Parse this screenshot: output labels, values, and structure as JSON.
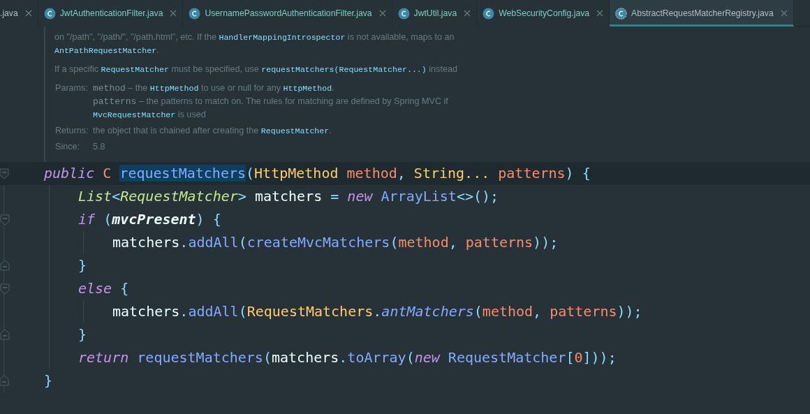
{
  "tabs": [
    {
      "label": ".java",
      "kind": "plain",
      "selected": false
    },
    {
      "label": "JwtAuthenticationFilter.java",
      "kind": "class",
      "selected": false
    },
    {
      "label": "UsernamePasswordAuthenticationFilter.java",
      "kind": "class",
      "selected": false
    },
    {
      "label": "JwtUtil.java",
      "kind": "class",
      "selected": false
    },
    {
      "label": "WebSecurityConfig.java",
      "kind": "class",
      "selected": false
    },
    {
      "label": "AbstractRequestMatcherRegistry.java",
      "kind": "abstract-class",
      "selected": true
    }
  ],
  "doc": {
    "paragraphs": [
      [
        {
          "kind": "text",
          "text": "on \"/path\", \"/path/\", \"/path.html\", etc. If the "
        },
        {
          "kind": "code",
          "text": "HandlerMappingIntrospector"
        },
        {
          "kind": "text",
          "text": " is not available, maps to an "
        },
        {
          "kind": "code",
          "text": "AntPathRequestMatcher"
        },
        {
          "kind": "text",
          "text": "."
        }
      ],
      [
        {
          "kind": "text",
          "text": "If a specific "
        },
        {
          "kind": "code",
          "text": "RequestMatcher"
        },
        {
          "kind": "text",
          "text": " must be specified, use "
        },
        {
          "kind": "code",
          "text": "requestMatchers(RequestMatcher...)"
        },
        {
          "kind": "text",
          "text": " instead"
        }
      ]
    ],
    "params_label": "Params:",
    "params": [
      {
        "name": "method",
        "segments": [
          {
            "kind": "text",
            "text": "– the "
          },
          {
            "kind": "code",
            "text": "HttpMethod"
          },
          {
            "kind": "text",
            "text": " to use or null for any "
          },
          {
            "kind": "code",
            "text": "HttpMethod"
          },
          {
            "kind": "text",
            "text": "."
          }
        ]
      },
      {
        "name": "patterns",
        "segments": [
          {
            "kind": "text",
            "text": "– the patterns to match on. The rules for matching are defined by Spring MVC if "
          },
          {
            "kind": "code",
            "text": "MvcRequestMatcher"
          },
          {
            "kind": "text",
            "text": " is used"
          }
        ]
      }
    ],
    "returns_label": "Returns:",
    "returns": [
      {
        "kind": "text",
        "text": "the object that is chained after creating the "
      },
      {
        "kind": "code",
        "text": "RequestMatcher"
      },
      {
        "kind": "text",
        "text": "."
      }
    ],
    "since_label": "Since:",
    "since": "5.8"
  },
  "code": [
    {
      "current": true,
      "kind": "fold-start",
      "tokens": [
        {
          "kind": "keyword",
          "text": "public "
        },
        {
          "kind": "typeparam",
          "text": "C "
        },
        {
          "kind": "selection",
          "text": "requestMatchers"
        },
        {
          "kind": "punct",
          "text": "("
        },
        {
          "kind": "type",
          "text": "HttpMethod "
        },
        {
          "kind": "param",
          "text": "method"
        },
        {
          "kind": "punct",
          "text": ", "
        },
        {
          "kind": "type",
          "text": "String... "
        },
        {
          "kind": "param",
          "text": "patterns"
        },
        {
          "kind": "punct",
          "text": ") {"
        }
      ],
      "children": [
        {
          "current": false,
          "tokens": [
            {
              "kind": "generic",
              "text": "List"
            },
            {
              "kind": "punct",
              "text": "<"
            },
            {
              "kind": "generic",
              "text": "RequestMatcher"
            },
            {
              "kind": "punct",
              "text": "> "
            },
            {
              "kind": "ident",
              "text": "matchers "
            },
            {
              "kind": "punct",
              "text": "= "
            },
            {
              "kind": "keyword",
              "text": "new "
            },
            {
              "kind": "method",
              "text": "ArrayList"
            },
            {
              "kind": "punct",
              "text": "<>();"
            }
          ]
        },
        {
          "current": false,
          "kind": "fold-start",
          "tokens": [
            {
              "kind": "keyword",
              "text": "if "
            },
            {
              "kind": "punct",
              "text": "("
            },
            {
              "kind": "field",
              "text": "mvcPresent"
            },
            {
              "kind": "punct",
              "text": ") {"
            }
          ],
          "children": [
            {
              "current": false,
              "tokens": [
                {
                  "kind": "ident",
                  "text": "matchers"
                },
                {
                  "kind": "punct",
                  "text": "."
                },
                {
                  "kind": "method",
                  "text": "addAll"
                },
                {
                  "kind": "punct",
                  "text": "("
                },
                {
                  "kind": "method",
                  "text": "createMvcMatchers"
                },
                {
                  "kind": "punct",
                  "text": "("
                },
                {
                  "kind": "param",
                  "text": "method"
                },
                {
                  "kind": "punct",
                  "text": ", "
                },
                {
                  "kind": "param",
                  "text": "patterns"
                },
                {
                  "kind": "punct",
                  "text": "));"
                }
              ]
            }
          ]
        },
        {
          "current": false,
          "kind": "fold-end",
          "tokens": [
            {
              "kind": "punct",
              "text": "}"
            }
          ]
        },
        {
          "current": false,
          "kind": "fold-start",
          "tokens": [
            {
              "kind": "keyword",
              "text": "else "
            },
            {
              "kind": "punct",
              "text": "{"
            }
          ],
          "children": [
            {
              "current": false,
              "tokens": [
                {
                  "kind": "ident",
                  "text": "matchers"
                },
                {
                  "kind": "punct",
                  "text": "."
                },
                {
                  "kind": "method",
                  "text": "addAll"
                },
                {
                  "kind": "punct",
                  "text": "("
                },
                {
                  "kind": "type",
                  "text": "RequestMatchers"
                },
                {
                  "kind": "punct",
                  "text": "."
                },
                {
                  "kind": "static",
                  "text": "antMatchers"
                },
                {
                  "kind": "punct",
                  "text": "("
                },
                {
                  "kind": "param",
                  "text": "method"
                },
                {
                  "kind": "punct",
                  "text": ", "
                },
                {
                  "kind": "param",
                  "text": "patterns"
                },
                {
                  "kind": "punct",
                  "text": "));"
                }
              ]
            }
          ]
        },
        {
          "current": false,
          "kind": "fold-end",
          "tokens": [
            {
              "kind": "punct",
              "text": "}"
            }
          ]
        },
        {
          "current": false,
          "tokens": [
            {
              "kind": "keyword",
              "text": "return "
            },
            {
              "kind": "method",
              "text": "requestMatchers"
            },
            {
              "kind": "punct",
              "text": "("
            },
            {
              "kind": "ident",
              "text": "matchers"
            },
            {
              "kind": "punct",
              "text": "."
            },
            {
              "kind": "method",
              "text": "toArray"
            },
            {
              "kind": "punct",
              "text": "("
            },
            {
              "kind": "keyword",
              "text": "new "
            },
            {
              "kind": "method",
              "text": "RequestMatcher"
            },
            {
              "kind": "punct",
              "text": "["
            },
            {
              "kind": "number",
              "text": "0"
            },
            {
              "kind": "punct",
              "text": "]));"
            }
          ]
        }
      ]
    },
    {
      "current": false,
      "kind": "fold-end",
      "tokens": [
        {
          "kind": "punct",
          "text": "}"
        }
      ]
    }
  ]
}
